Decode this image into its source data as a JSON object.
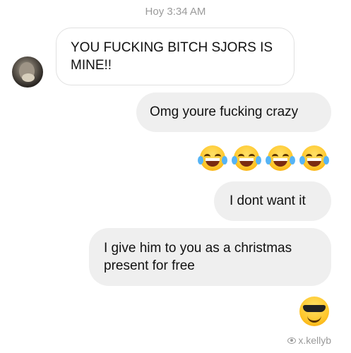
{
  "conversation": {
    "timestamp": "Hoy 3:34 AM",
    "messages": [
      {
        "sender": "other",
        "text": "YOU FUCKING BITCH SJORS IS MINE!!"
      },
      {
        "sender": "me",
        "text": "Omg youre fucking crazy"
      },
      {
        "sender": "me",
        "emoji": [
          "face-with-tears-of-joy",
          "face-with-tears-of-joy",
          "face-with-tears-of-joy",
          "face-with-tears-of-joy"
        ]
      },
      {
        "sender": "me",
        "text": "I dont want it"
      },
      {
        "sender": "me",
        "text": "I give him to you as a christmas present for free"
      },
      {
        "sender": "me",
        "emoji": [
          "smiling-face-with-sunglasses"
        ]
      }
    ],
    "seen_by": "x.kellyb"
  },
  "colors": {
    "sent_bubble": "#efefef",
    "received_bubble_border": "#e1e1e1",
    "meta_text": "#9a9a9a"
  }
}
